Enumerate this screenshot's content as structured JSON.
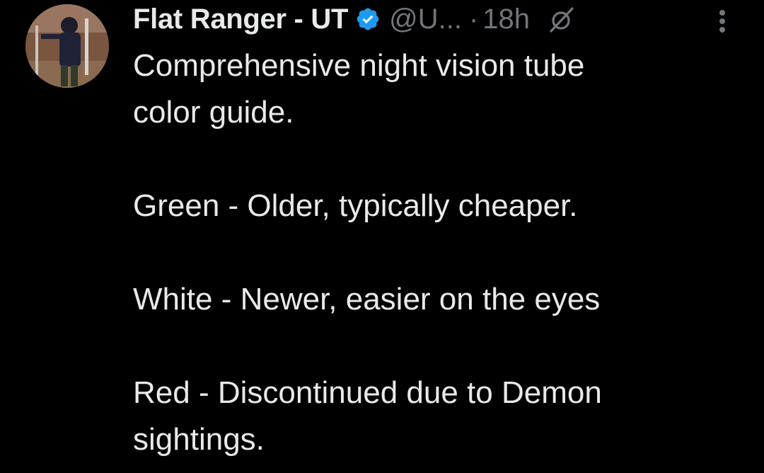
{
  "tweet": {
    "author": {
      "display_name": "Flat Ranger - UT",
      "handle": "@U...",
      "verified": true,
      "avatar_icon": "avatar-photo"
    },
    "separator": "·",
    "time": "18h",
    "icons": {
      "verified": "verified-badge-icon",
      "grok": "grok-slash-icon",
      "more": "more-options-icon"
    },
    "text": "Comprehensive night vision tube\ncolor guide.\n\nGreen - Older, typically cheaper.\n\nWhite - Newer, easier on the eyes\n\nRed - Discontinued due to Demon\nsightings.",
    "colors": {
      "background": "#000000",
      "text": "#e7e9ea",
      "secondary": "#71767b",
      "verified_blue": "#1d9bf0"
    }
  }
}
